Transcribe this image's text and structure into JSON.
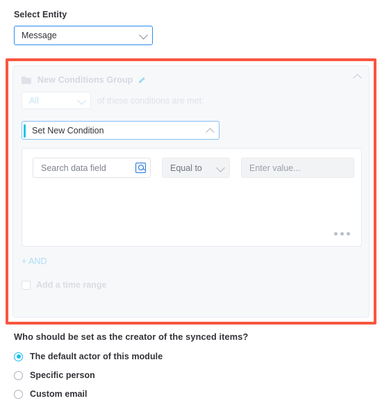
{
  "entity": {
    "label": "Select Entity",
    "value": "Message",
    "chevron_icon": "chevron-down-icon"
  },
  "conditions_group": {
    "folder_icon": "folder-icon",
    "title": "New Conditions Group",
    "edit_icon": "pencil-icon",
    "collapse_icon": "chevron-up-icon",
    "match_select": {
      "value": "All",
      "chevron_icon": "chevron-down-icon"
    },
    "match_suffix": "of these conditions are met:",
    "set_condition": {
      "value": "Set New Condition",
      "chevron_icon": "chevron-up-icon"
    },
    "condition_row": {
      "field_placeholder": "Search data field",
      "field_icon": "search-icon",
      "operator_value": "Equal to",
      "operator_chevron_icon": "chevron-down-icon",
      "value_placeholder": "Enter value..."
    },
    "more_icon": "ellipsis-icon",
    "and_link": "+ AND",
    "time_range": {
      "label": "Add a time range",
      "checked": false
    }
  },
  "creator": {
    "question": "Who should be set as the creator of the synced items?",
    "options": [
      {
        "label": "The default actor of this module",
        "selected": true
      },
      {
        "label": "Specific person",
        "selected": false
      },
      {
        "label": "Custom email",
        "selected": false
      }
    ]
  },
  "colors": {
    "highlight_border": "#f9563f",
    "accent_blue": "#2b8cf0",
    "accent_cyan": "#1bbcf0",
    "muted_text": "#d4d8e0"
  }
}
